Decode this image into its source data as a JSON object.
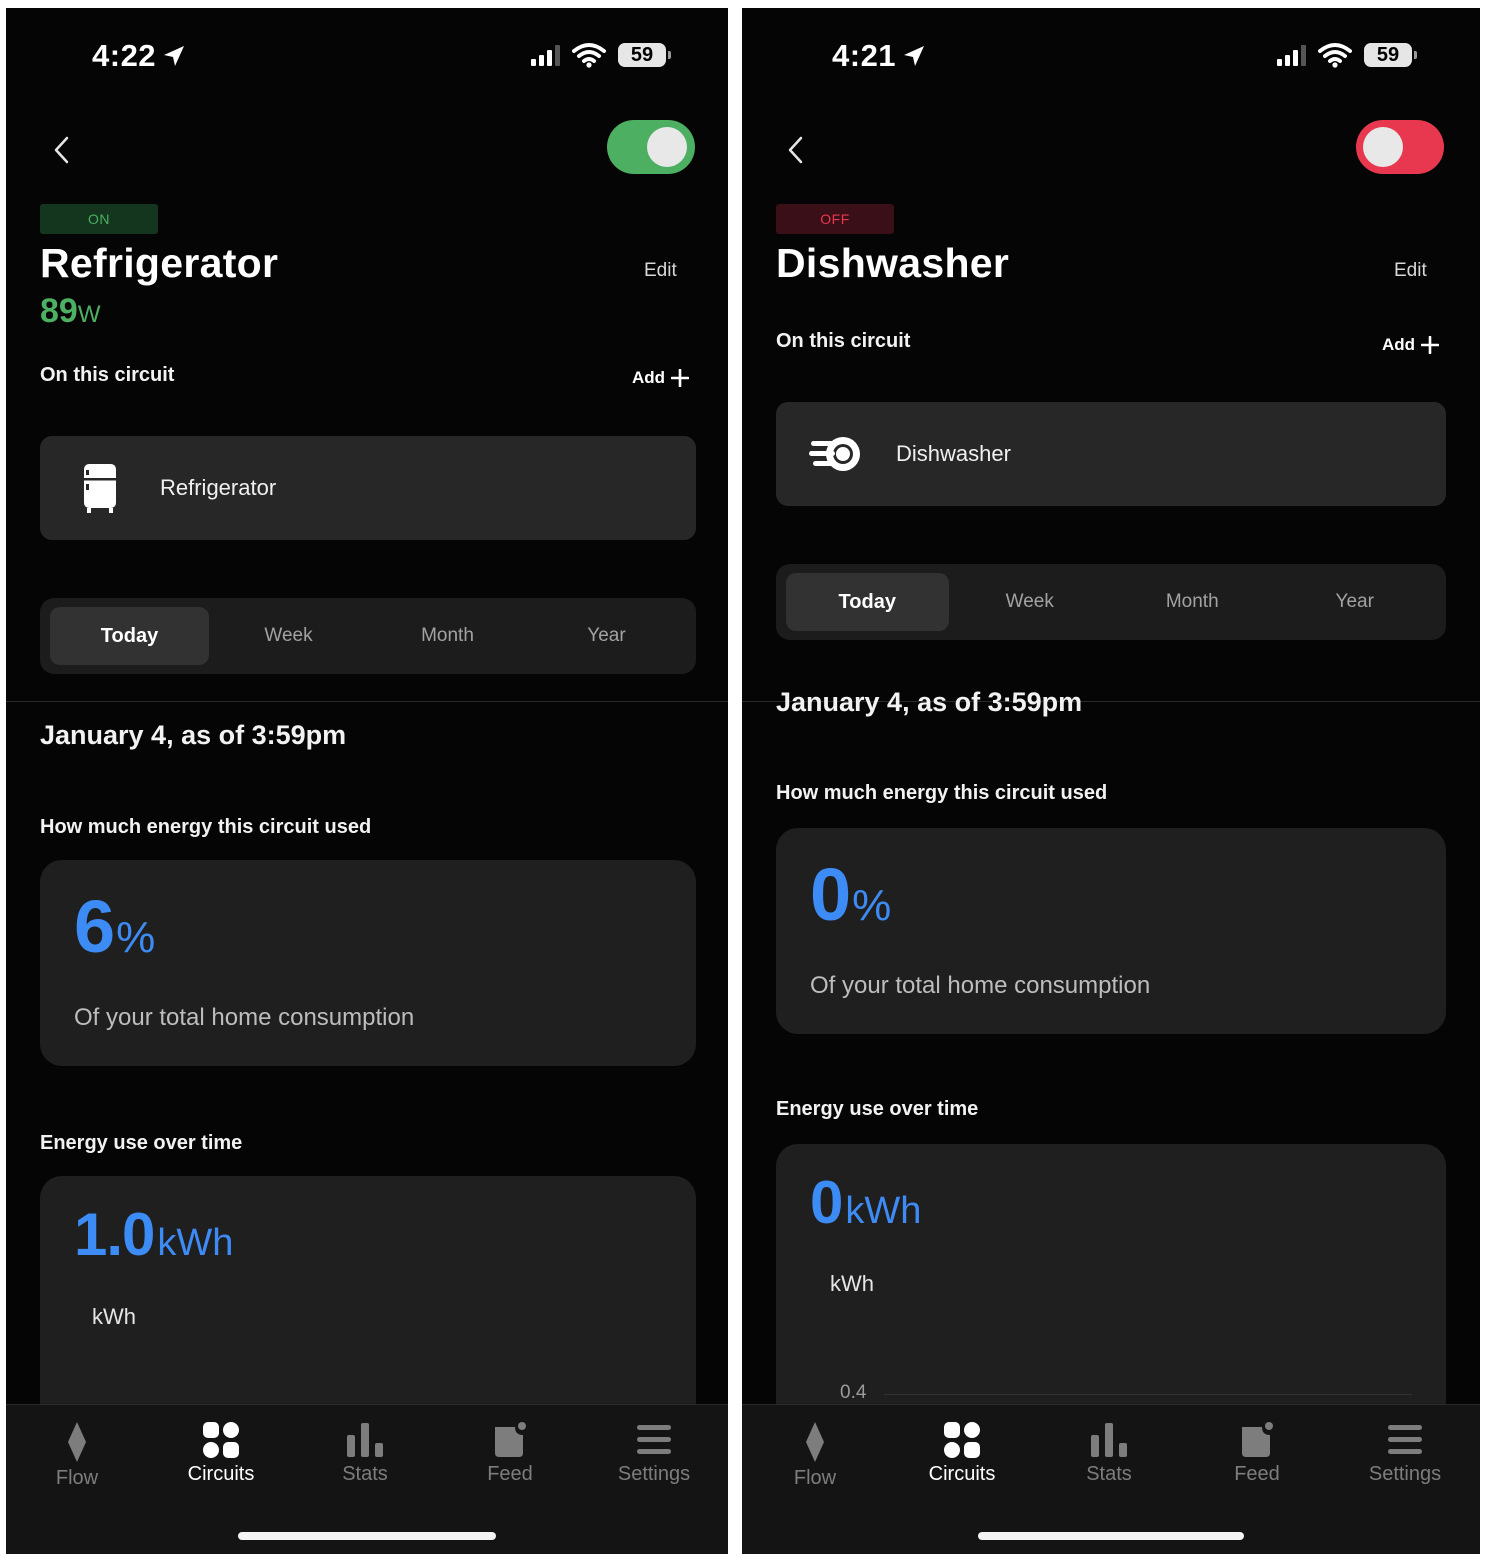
{
  "screens": [
    {
      "status_bar": {
        "time": "4:22",
        "battery": "59"
      },
      "toggle": {
        "state": "on",
        "color": "#4caf61"
      },
      "badge": {
        "label": "ON",
        "bg": "#14361f",
        "color": "#4caf61"
      },
      "device_name": "Refrigerator",
      "edit_label": "Edit",
      "power": {
        "value": "89",
        "unit": "W"
      },
      "circuit_label": "On this circuit",
      "add_label": "Add",
      "circuit_items": [
        {
          "icon": "refrigerator-icon",
          "label": "Refrigerator"
        }
      ],
      "periods": [
        "Today",
        "Week",
        "Month",
        "Year"
      ],
      "selected_period": "Today",
      "date_heading": "January 4, as of 3:59pm",
      "share_section_label": "How much energy this circuit used",
      "share": {
        "value": "6",
        "unit": "%",
        "caption": "Of your total home consumption"
      },
      "energy_section_label": "Energy use over time",
      "energy": {
        "value": "1.0",
        "unit": "kWh",
        "axis_unit": "kWh"
      },
      "tabs": [
        "Flow",
        "Circuits",
        "Stats",
        "Feed",
        "Settings"
      ],
      "active_tab": "Circuits"
    },
    {
      "status_bar": {
        "time": "4:21",
        "battery": "59"
      },
      "toggle": {
        "state": "off",
        "color": "#e8384f"
      },
      "badge": {
        "label": "OFF",
        "bg": "#3a0f17",
        "color": "#e8384f"
      },
      "device_name": "Dishwasher",
      "edit_label": "Edit",
      "circuit_label": "On this circuit",
      "add_label": "Add",
      "circuit_items": [
        {
          "icon": "dishwasher-icon",
          "label": "Dishwasher"
        }
      ],
      "periods": [
        "Today",
        "Week",
        "Month",
        "Year"
      ],
      "selected_period": "Today",
      "date_heading": "January 4, as of 3:59pm",
      "share_section_label": "How much energy this circuit used",
      "share": {
        "value": "0",
        "unit": "%",
        "caption": "Of your total home consumption"
      },
      "energy_section_label": "Energy use over time",
      "energy": {
        "value": "0",
        "unit": "kWh",
        "axis_unit": "kWh",
        "y_tick": "0.4"
      },
      "tabs": [
        "Flow",
        "Circuits",
        "Stats",
        "Feed",
        "Settings"
      ],
      "active_tab": "Circuits"
    }
  ]
}
